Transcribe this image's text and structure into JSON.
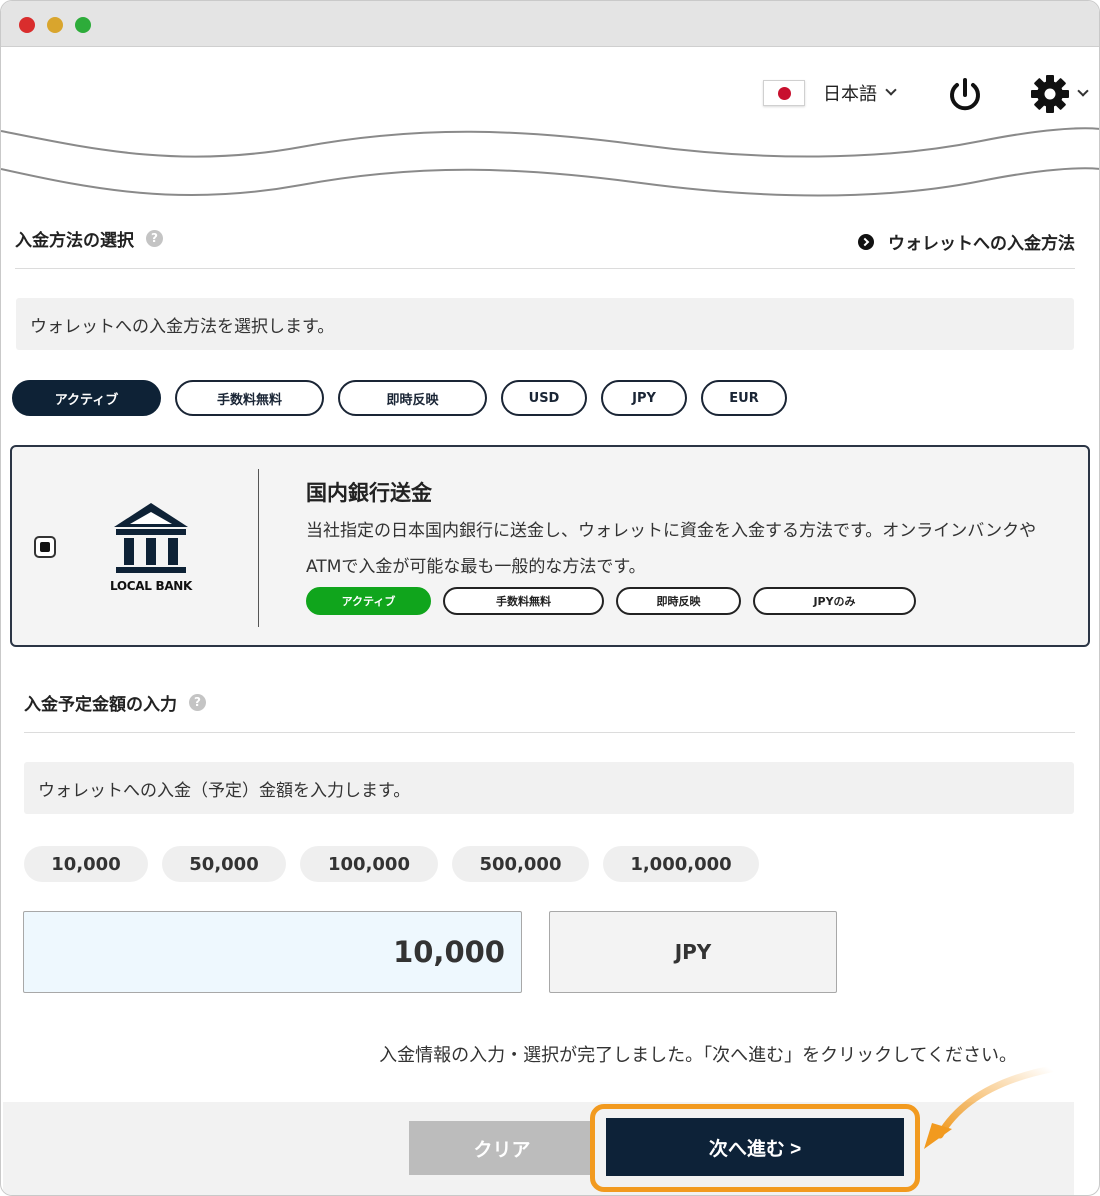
{
  "header": {
    "language": "日本語"
  },
  "method_section": {
    "title": "入金方法の選択",
    "help": "?",
    "link": "ウォレットへの入金方法",
    "description": "ウォレットへの入金方法を選択します。",
    "filters": [
      {
        "label": "アクティブ",
        "active": true
      },
      {
        "label": "手数料無料",
        "active": false
      },
      {
        "label": "即時反映",
        "active": false
      },
      {
        "label": "USD",
        "active": false
      },
      {
        "label": "JPY",
        "active": false
      },
      {
        "label": "EUR",
        "active": false
      }
    ],
    "card": {
      "logo_text": "LOCAL BANK",
      "title": "国内銀行送金",
      "desc_line1": "当社指定の日本国内銀行に送金し、ウォレットに資金を入金する方法です。オンラインバンクや",
      "desc_line2": "ATMで入金が可能な最も一般的な方法です。",
      "tags": [
        "アクティブ",
        "手数料無料",
        "即時反映",
        "JPYのみ"
      ]
    }
  },
  "amount_section": {
    "title": "入金予定金額の入力",
    "help": "?",
    "description": "ウォレットへの入金（予定）金額を入力します。",
    "presets": [
      "10,000",
      "50,000",
      "100,000",
      "500,000",
      "1,000,000"
    ],
    "value": "10,000",
    "currency": "JPY"
  },
  "notice": "入金情報の入力・選択が完了しました。「次へ進む」をクリックしてください。",
  "buttons": {
    "clear": "クリア",
    "next": "次へ進む >"
  },
  "colors": {
    "navy": "#0e2236",
    "active_green": "#10a51c",
    "highlight_orange": "#f29a1f"
  }
}
